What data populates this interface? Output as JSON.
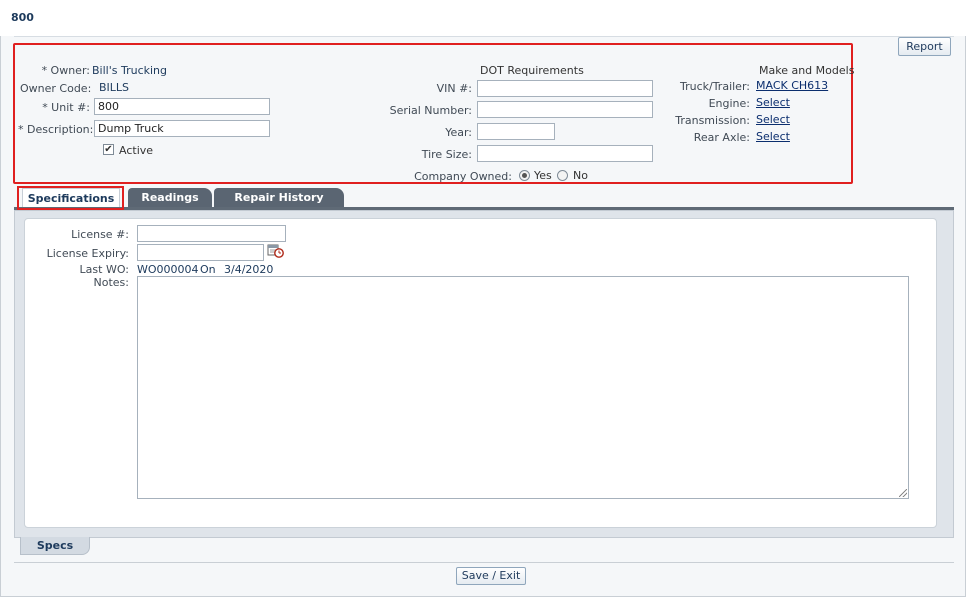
{
  "page": {
    "title": "800",
    "report_label": "Report",
    "save_exit_label": "Save / Exit"
  },
  "header_form": {
    "owner": {
      "label": "* Owner:",
      "value": "Bill's Trucking"
    },
    "owner_code": {
      "label": "Owner Code:",
      "value": "BILLS"
    },
    "unit": {
      "label": "* Unit #:",
      "value": "800"
    },
    "description": {
      "label": "* Description:",
      "value": "Dump Truck"
    },
    "active": {
      "label": "Active",
      "checked": true
    }
  },
  "dot": {
    "heading": "DOT Requirements",
    "vin": {
      "label": "VIN #:",
      "value": ""
    },
    "serial": {
      "label": "Serial Number:",
      "value": ""
    },
    "year": {
      "label": "Year:",
      "value": ""
    },
    "tire_size": {
      "label": "Tire Size:",
      "value": ""
    },
    "company_owned": {
      "label": "Company Owned:",
      "yes": "Yes",
      "no": "No",
      "selected": "Yes"
    }
  },
  "make_models": {
    "heading": "Make and Models",
    "truck_trailer": {
      "label": "Truck/Trailer:",
      "value": "MACK CH613"
    },
    "engine": {
      "label": "Engine:",
      "value": "Select"
    },
    "transmission": {
      "label": "Transmission:",
      "value": "Select"
    },
    "rear_axle": {
      "label": "Rear Axle:",
      "value": "Select"
    }
  },
  "tabs": [
    {
      "label": "Specifications",
      "active": true
    },
    {
      "label": "Readings",
      "active": false
    },
    {
      "label": "Repair History",
      "active": false
    }
  ],
  "specs": {
    "license": {
      "label": "License #:",
      "value": ""
    },
    "license_expiry": {
      "label": "License Expiry:",
      "value": ""
    },
    "last_wo": {
      "label": "Last WO:",
      "wo": "WO000004",
      "on": "On",
      "date": "3/4/2020"
    },
    "notes": {
      "label": "Notes:",
      "value": ""
    }
  },
  "bottom_tab": {
    "label": "Specs"
  },
  "colors": {
    "highlight": "#e02020",
    "tab_dark": "#5a6572",
    "link": "#0b2e6e"
  },
  "icons": {
    "calendar": "calendar-clock-icon"
  }
}
